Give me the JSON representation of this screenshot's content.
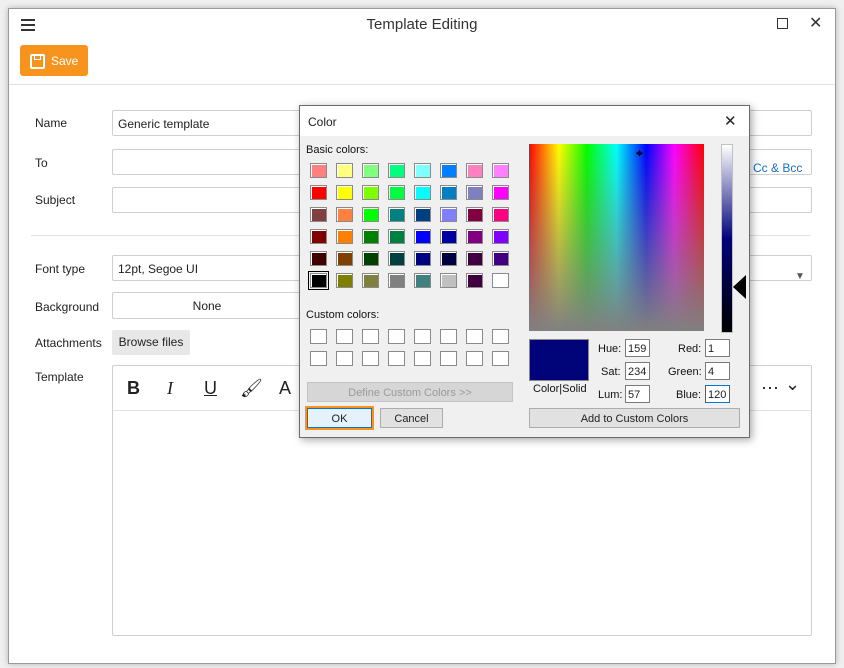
{
  "window": {
    "title": "Template Editing"
  },
  "toolbar": {
    "save_label": "Save"
  },
  "form": {
    "name_label": "Name",
    "name_value": "Generic template",
    "to_label": "To",
    "to_value": "",
    "cc_bcc_link": "d Cc & Bcc",
    "subject_label": "Subject",
    "subject_value": "",
    "font_type_label": "Font type",
    "font_type_value": "12pt, Segoe UI",
    "background_label": "Background",
    "background_value": "None",
    "attachments_label": "Attachments",
    "browse_label": "Browse files",
    "template_label": "Template"
  },
  "editor_toolbar": {
    "bold": "B",
    "italic": "I",
    "underline": "U",
    "font_a": "A",
    "more": "⋯",
    "chevron": "⌄"
  },
  "color_dialog": {
    "title": "Color",
    "basic_colors_label": "Basic colors:",
    "custom_colors_label": "Custom colors:",
    "define_custom_label": "Define Custom Colors >>",
    "ok_label": "OK",
    "cancel_label": "Cancel",
    "color_solid_label": "Color|Solid",
    "add_custom_label": "Add to Custom Colors",
    "hue_label": "Hue:",
    "hue_value": "159",
    "sat_label": "Sat:",
    "sat_value": "234",
    "lum_label": "Lum:",
    "lum_value": "57",
    "red_label": "Red:",
    "red_value": "1",
    "green_label": "Green:",
    "green_value": "4",
    "blue_label": "Blue:",
    "blue_value": "120",
    "current_color": "#010478",
    "basic_colors": [
      "#ff8080",
      "#ffff80",
      "#80ff80",
      "#00ff80",
      "#80ffff",
      "#0080ff",
      "#ff80c0",
      "#ff80ff",
      "#ff0000",
      "#ffff00",
      "#80ff00",
      "#00ff40",
      "#00ffff",
      "#0080c0",
      "#8080c0",
      "#ff00ff",
      "#804040",
      "#ff8040",
      "#00ff00",
      "#008080",
      "#004080",
      "#8080ff",
      "#800040",
      "#ff0080",
      "#800000",
      "#ff8000",
      "#008000",
      "#008040",
      "#0000ff",
      "#0000a0",
      "#800080",
      "#8000ff",
      "#400000",
      "#804000",
      "#004000",
      "#004040",
      "#000080",
      "#000040",
      "#400040",
      "#400080",
      "#000000",
      "#808000",
      "#808040",
      "#808080",
      "#408080",
      "#c0c0c0",
      "#400040",
      "#ffffff"
    ],
    "selected_index": 40
  },
  "accent_color": "#f7941d",
  "link_color": "#1a6fc4"
}
